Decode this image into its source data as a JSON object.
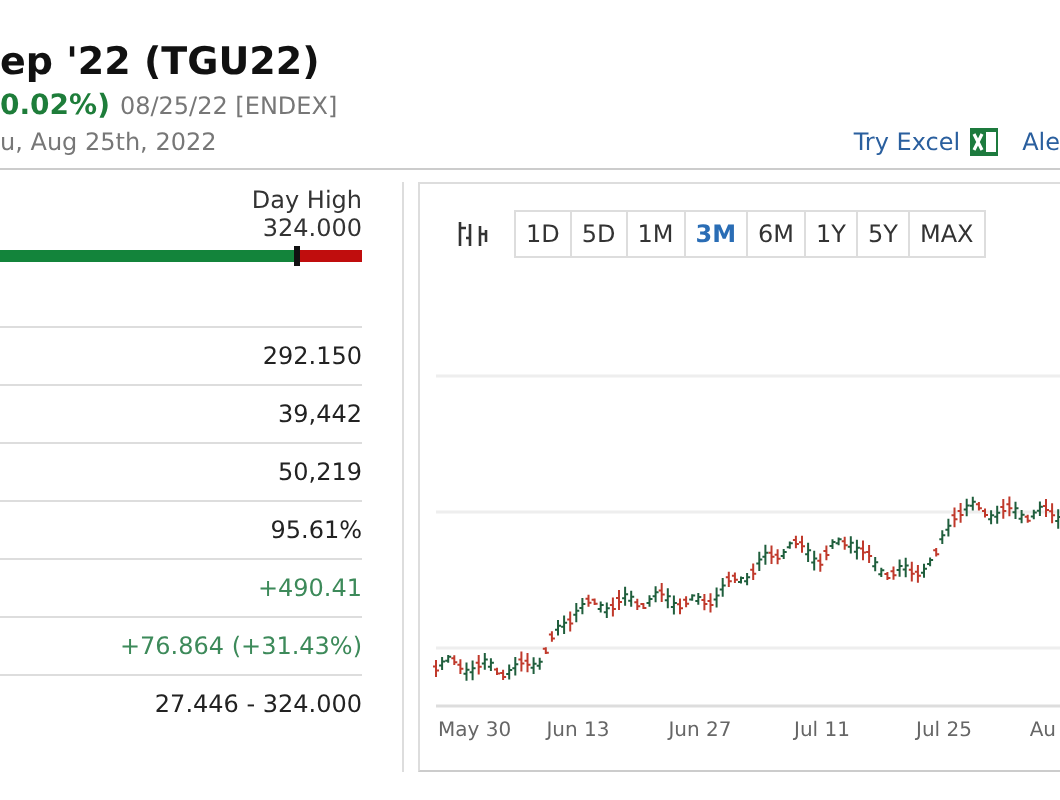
{
  "header": {
    "title": "ep '22 (TGU22)",
    "change": "0.02%)",
    "quote_time": "08/25/22 [ENDEX]",
    "date": "u, Aug 25th, 2022"
  },
  "links": [
    {
      "label": "Try Excel",
      "kind": "excel"
    },
    {
      "label": "Ale",
      "kind": "plain"
    }
  ],
  "day_range": {
    "label": "Day High",
    "value": "324.000",
    "level": 0.82
  },
  "stats": [
    {
      "value": "292.150",
      "color": "#222222"
    },
    {
      "value": "39,442",
      "color": "#222222"
    },
    {
      "value": "50,219",
      "color": "#222222"
    },
    {
      "value": "95.61%",
      "color": "#222222"
    },
    {
      "value": "+490.41",
      "color": "#3d8a5a"
    },
    {
      "value": "+76.864 (+31.43%)",
      "color": "#3d8a5a"
    },
    {
      "value": "27.446 - 324.000",
      "color": "#222222"
    }
  ],
  "chart": {
    "ranges": [
      {
        "label": "1D",
        "selected": false
      },
      {
        "label": "5D",
        "selected": false
      },
      {
        "label": "1M",
        "selected": false
      },
      {
        "label": "3M",
        "selected": true
      },
      {
        "label": "6M",
        "selected": false
      },
      {
        "label": "1Y",
        "selected": false
      },
      {
        "label": "5Y",
        "selected": false
      },
      {
        "label": "MAX",
        "selected": false
      }
    ],
    "x_labels": [
      "May 30",
      "Jun 13",
      "Jun 27",
      "Jul 11",
      "Jul 25",
      "Au"
    ]
  }
}
